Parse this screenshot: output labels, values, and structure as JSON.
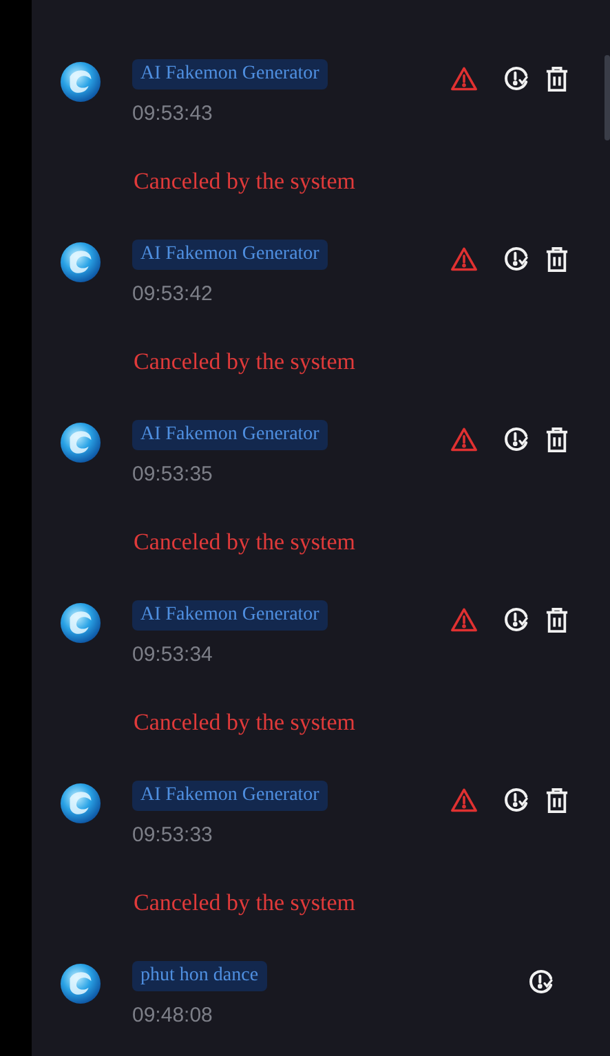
{
  "entries": [
    {
      "kind": "canceled",
      "tag": "AI Fakemon Generator",
      "time": "09:53:43",
      "message": "Canceled by the system"
    },
    {
      "kind": "canceled",
      "tag": "AI Fakemon Generator",
      "time": "09:53:42",
      "message": "Canceled by the system"
    },
    {
      "kind": "canceled",
      "tag": "AI Fakemon Generator",
      "time": "09:53:35",
      "message": "Canceled by the system"
    },
    {
      "kind": "canceled",
      "tag": "AI Fakemon Generator",
      "time": "09:53:34",
      "message": "Canceled by the system"
    },
    {
      "kind": "canceled",
      "tag": "AI Fakemon Generator",
      "time": "09:53:33",
      "message": "Canceled by the system"
    },
    {
      "kind": "pending",
      "tag": "phut hon dance",
      "time": "09:48:08"
    }
  ]
}
